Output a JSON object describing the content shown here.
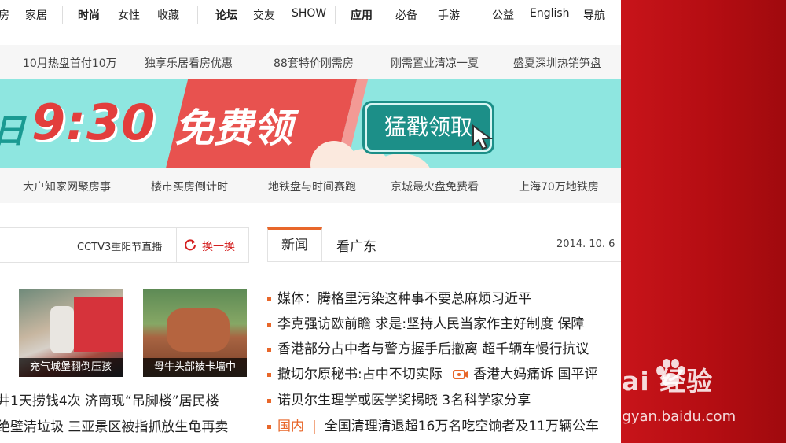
{
  "top_nav": {
    "group1": [
      "房",
      "家居"
    ],
    "group2": [
      "时尚",
      "女性",
      "收藏"
    ],
    "group3": [
      "论坛",
      "交友",
      "SHOW"
    ],
    "group4": [
      "应用",
      "必备",
      "手游"
    ],
    "group5": [
      "公益",
      "English",
      "导航"
    ]
  },
  "row1": [
    "10月热盘首付10万",
    "独享乐居看房优惠",
    "88套特价刚需房",
    "刚需置业清凉一夏",
    "盛夏深圳热销笋盘"
  ],
  "banner": {
    "prefix": "日",
    "time": "9:30",
    "free": "免费领",
    "button": "猛戳领取",
    "colors": {
      "bg": "#8ee6e0",
      "stripe": "#e8524f",
      "button": "#1c8f88"
    }
  },
  "row2": [
    "大户知家网聚房事",
    "楼市买房倒计时",
    "地铁盘与时间赛跑",
    "京城最火盘免费看",
    "上海70万地铁房"
  ],
  "left_panel": {
    "cctv": "CCTV3重阳节直播",
    "swap": "换一换",
    "photos": [
      "充气城堡翻倒压孩",
      "母牛头部被卡墙中"
    ],
    "news": [
      "井1天捞钱4次  济南现“吊脚楼”居民楼",
      "绝壁清垃圾  三亚景区被指抓放生龟再卖"
    ]
  },
  "news_panel": {
    "tabs": [
      "新闻",
      "看广东"
    ],
    "date": "2014. 10. 6",
    "headlines": [
      "媒体：腾格里污染这种事不要总麻烦习近平",
      "李克强访欧前瞻  求是:坚持人民当家作主好制度  保障",
      "香港部分占中者与警方握手后撤离  超千辆车慢行抗议",
      "撒切尔原秘书:占中不切实际",
      "香港大妈痛诉  国平评",
      "诺贝尔生理学或医学奖揭晓  3名科学家分享"
    ],
    "domestic_label": "国内",
    "domestic_text": "全国清理清退超16万名吃空饷者及11万辆公车",
    "accent": "#e8672a"
  },
  "watermark": {
    "brand": "Bai 经验",
    "url": "jingyan.baidu.com"
  }
}
